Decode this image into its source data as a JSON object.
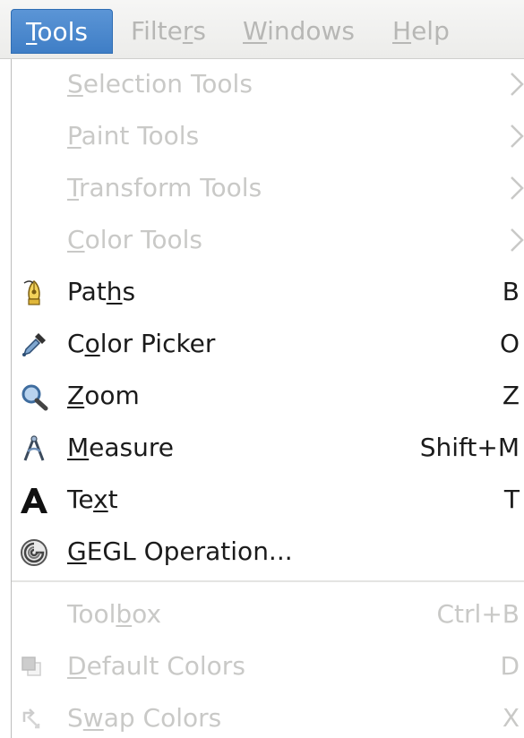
{
  "menubar": {
    "items": [
      {
        "label": "Tools",
        "mnemonic_index": 0
      },
      {
        "label": "Filters",
        "mnemonic_index": 5
      },
      {
        "label": "Windows",
        "mnemonic_index": 0
      },
      {
        "label": "Help",
        "mnemonic_index": 0
      }
    ]
  },
  "menu": {
    "items": [
      {
        "pre": "",
        "u": "S",
        "post": "election Tools",
        "accel": "",
        "submenu": true,
        "enabled": false,
        "icon": ""
      },
      {
        "pre": "",
        "u": "P",
        "post": "aint Tools",
        "accel": "",
        "submenu": true,
        "enabled": false,
        "icon": ""
      },
      {
        "pre": "",
        "u": "T",
        "post": "ransform Tools",
        "accel": "",
        "submenu": true,
        "enabled": false,
        "icon": ""
      },
      {
        "pre": "",
        "u": "C",
        "post": "olor Tools",
        "accel": "",
        "submenu": true,
        "enabled": false,
        "icon": ""
      },
      {
        "pre": "Pat",
        "u": "h",
        "post": "s",
        "accel": "B",
        "submenu": false,
        "enabled": true,
        "icon": "paths-icon"
      },
      {
        "pre": "C",
        "u": "o",
        "post": "lor Picker",
        "accel": "O",
        "submenu": false,
        "enabled": true,
        "icon": "color-picker-icon"
      },
      {
        "pre": "",
        "u": "Z",
        "post": "oom",
        "accel": "Z",
        "submenu": false,
        "enabled": true,
        "icon": "zoom-icon"
      },
      {
        "pre": "",
        "u": "M",
        "post": "easure",
        "accel": "Shift+M",
        "submenu": false,
        "enabled": true,
        "icon": "measure-icon"
      },
      {
        "pre": "Te",
        "u": "x",
        "post": "t",
        "accel": "T",
        "submenu": false,
        "enabled": true,
        "icon": "text-icon"
      },
      {
        "pre": "",
        "u": "G",
        "post": "EGL Operation...",
        "accel": "",
        "submenu": false,
        "enabled": true,
        "icon": "gegl-icon"
      },
      {
        "pre": "Tool",
        "u": "b",
        "post": "ox",
        "accel": "Ctrl+B",
        "submenu": false,
        "enabled": false,
        "icon": ""
      },
      {
        "pre": "",
        "u": "D",
        "post": "efault Colors",
        "accel": "D",
        "submenu": false,
        "enabled": false,
        "icon": "default-colors-icon"
      },
      {
        "pre": "S",
        "u": "w",
        "post": "ap Colors",
        "accel": "X",
        "submenu": false,
        "enabled": false,
        "icon": "swap-colors-icon"
      }
    ]
  }
}
